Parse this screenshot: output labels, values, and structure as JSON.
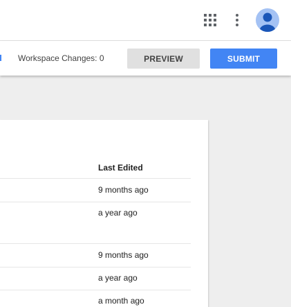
{
  "toolbar": {
    "apps_icon": "apps-grid-icon",
    "more_icon": "more-vert-icon",
    "avatar_icon": "account-avatar-icon"
  },
  "workspace": {
    "changes_text": "Workspace Changes: 0",
    "preview_label": "PREVIEW",
    "submit_label": "SUBMIT"
  },
  "table": {
    "column_header": "Last Edited",
    "rows": [
      {
        "last_edited": "9 months ago"
      },
      {
        "last_edited": "a year ago"
      },
      {
        "last_edited": "9 months ago"
      },
      {
        "last_edited": "a year ago"
      },
      {
        "last_edited": "a month ago"
      }
    ]
  },
  "colors": {
    "accent": "#4285f4",
    "avatar_bg": "#a4c2f4",
    "avatar_fg": "#1a56b8",
    "background": "#eeeeee"
  }
}
